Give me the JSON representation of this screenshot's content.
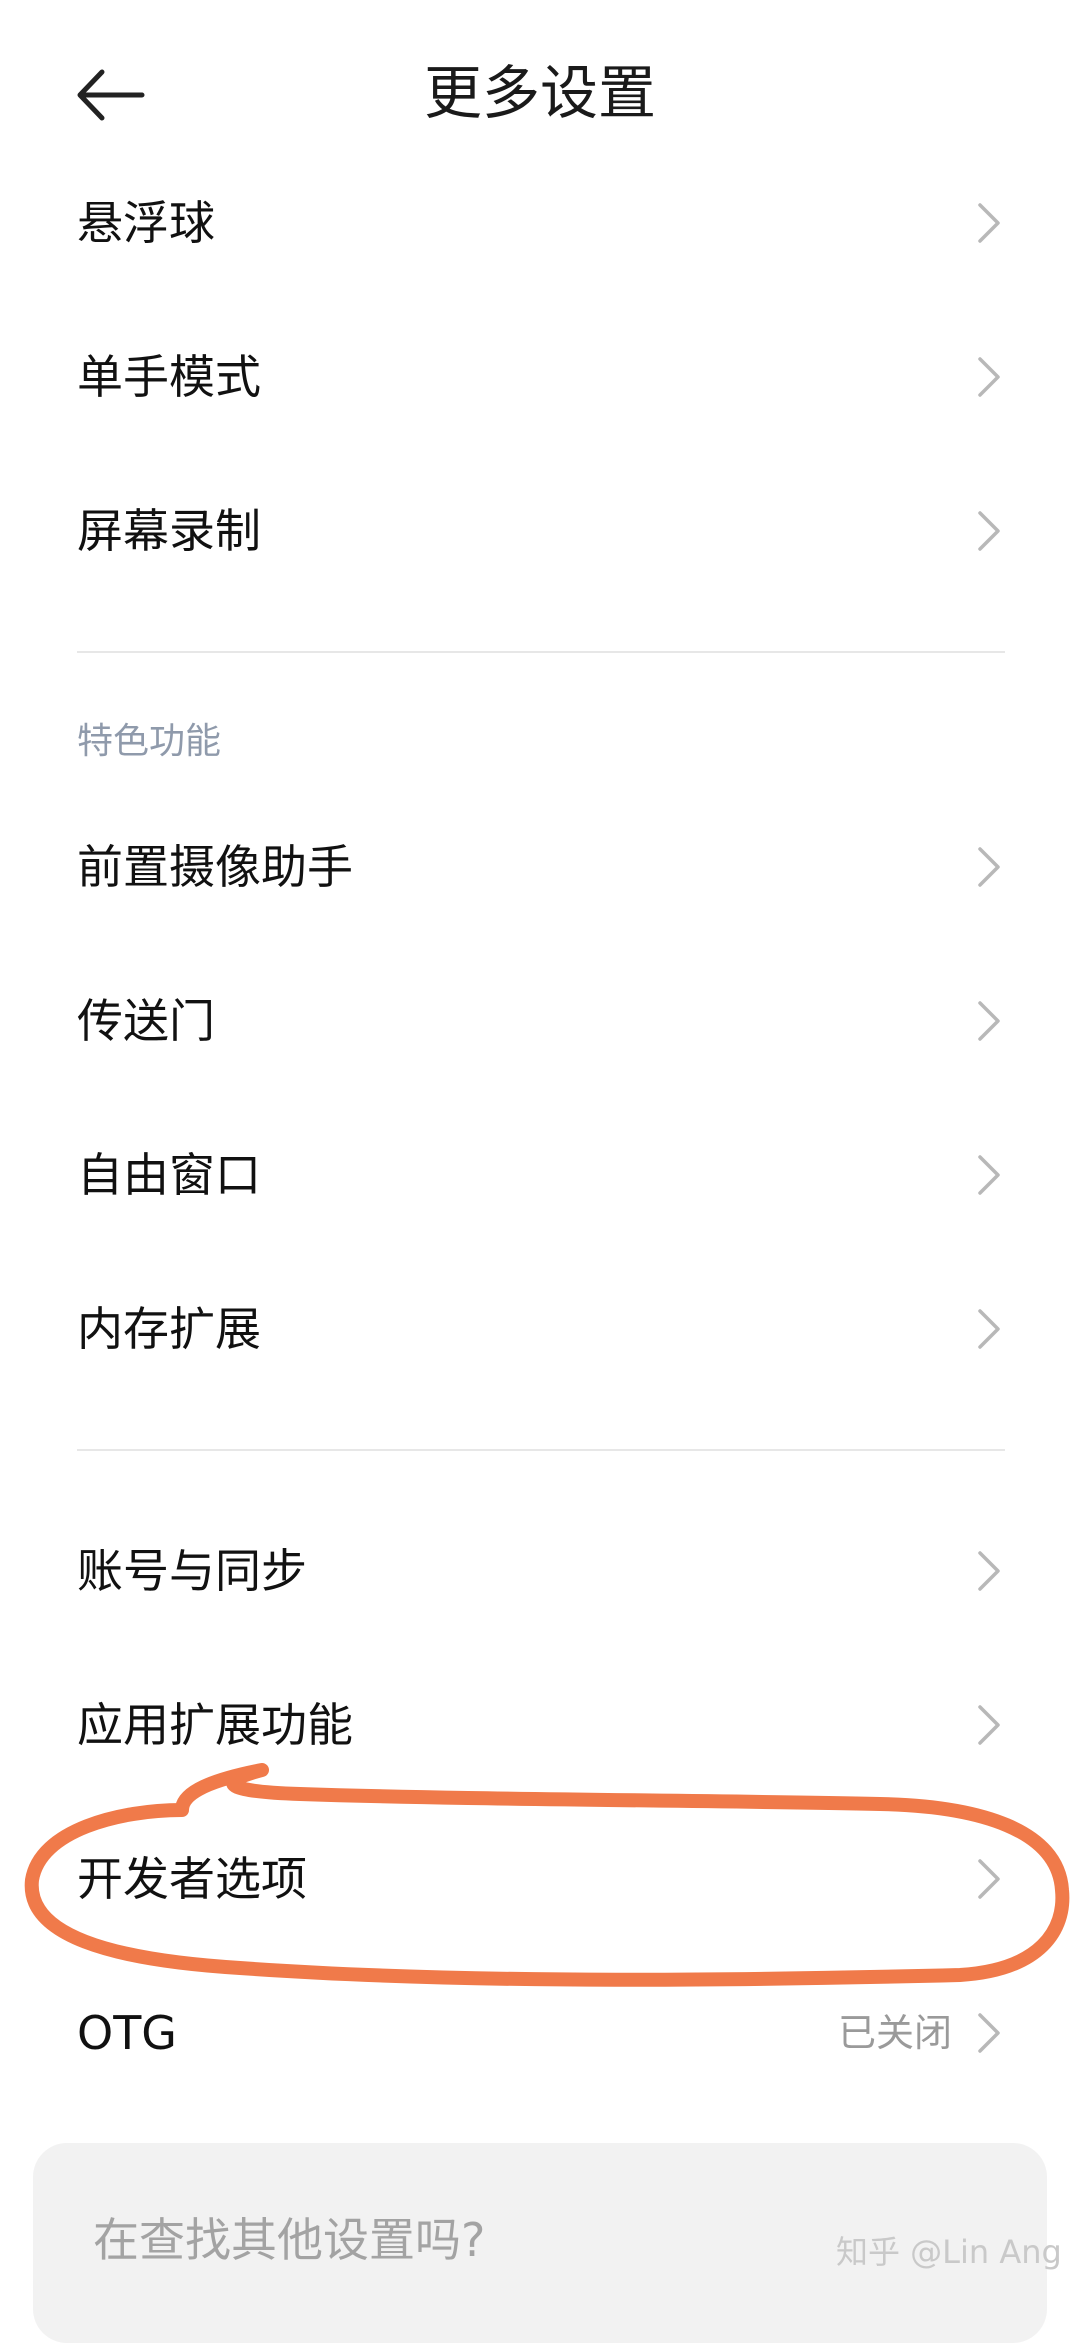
{
  "header": {
    "title": "更多设置",
    "back_icon": "arrow-left-icon"
  },
  "groups": [
    {
      "items": [
        {
          "label": "悬浮球"
        },
        {
          "label": "单手模式"
        },
        {
          "label": "屏幕录制"
        }
      ]
    },
    {
      "section_title": "特色功能",
      "items": [
        {
          "label": "前置摄像助手"
        },
        {
          "label": "传送门"
        },
        {
          "label": "自由窗口"
        },
        {
          "label": "内存扩展"
        }
      ]
    },
    {
      "items": [
        {
          "label": "账号与同步"
        },
        {
          "label": "应用扩展功能"
        },
        {
          "label": "开发者选项"
        },
        {
          "label": "OTG",
          "value": "已关闭"
        }
      ]
    }
  ],
  "search_prompt": "在查找其他设置吗?",
  "watermark": "知乎 @Lin Ang",
  "colors": {
    "annotation": "#f07a4a",
    "section_title": "#8f9aab",
    "chevron": "#b8b8b8"
  }
}
